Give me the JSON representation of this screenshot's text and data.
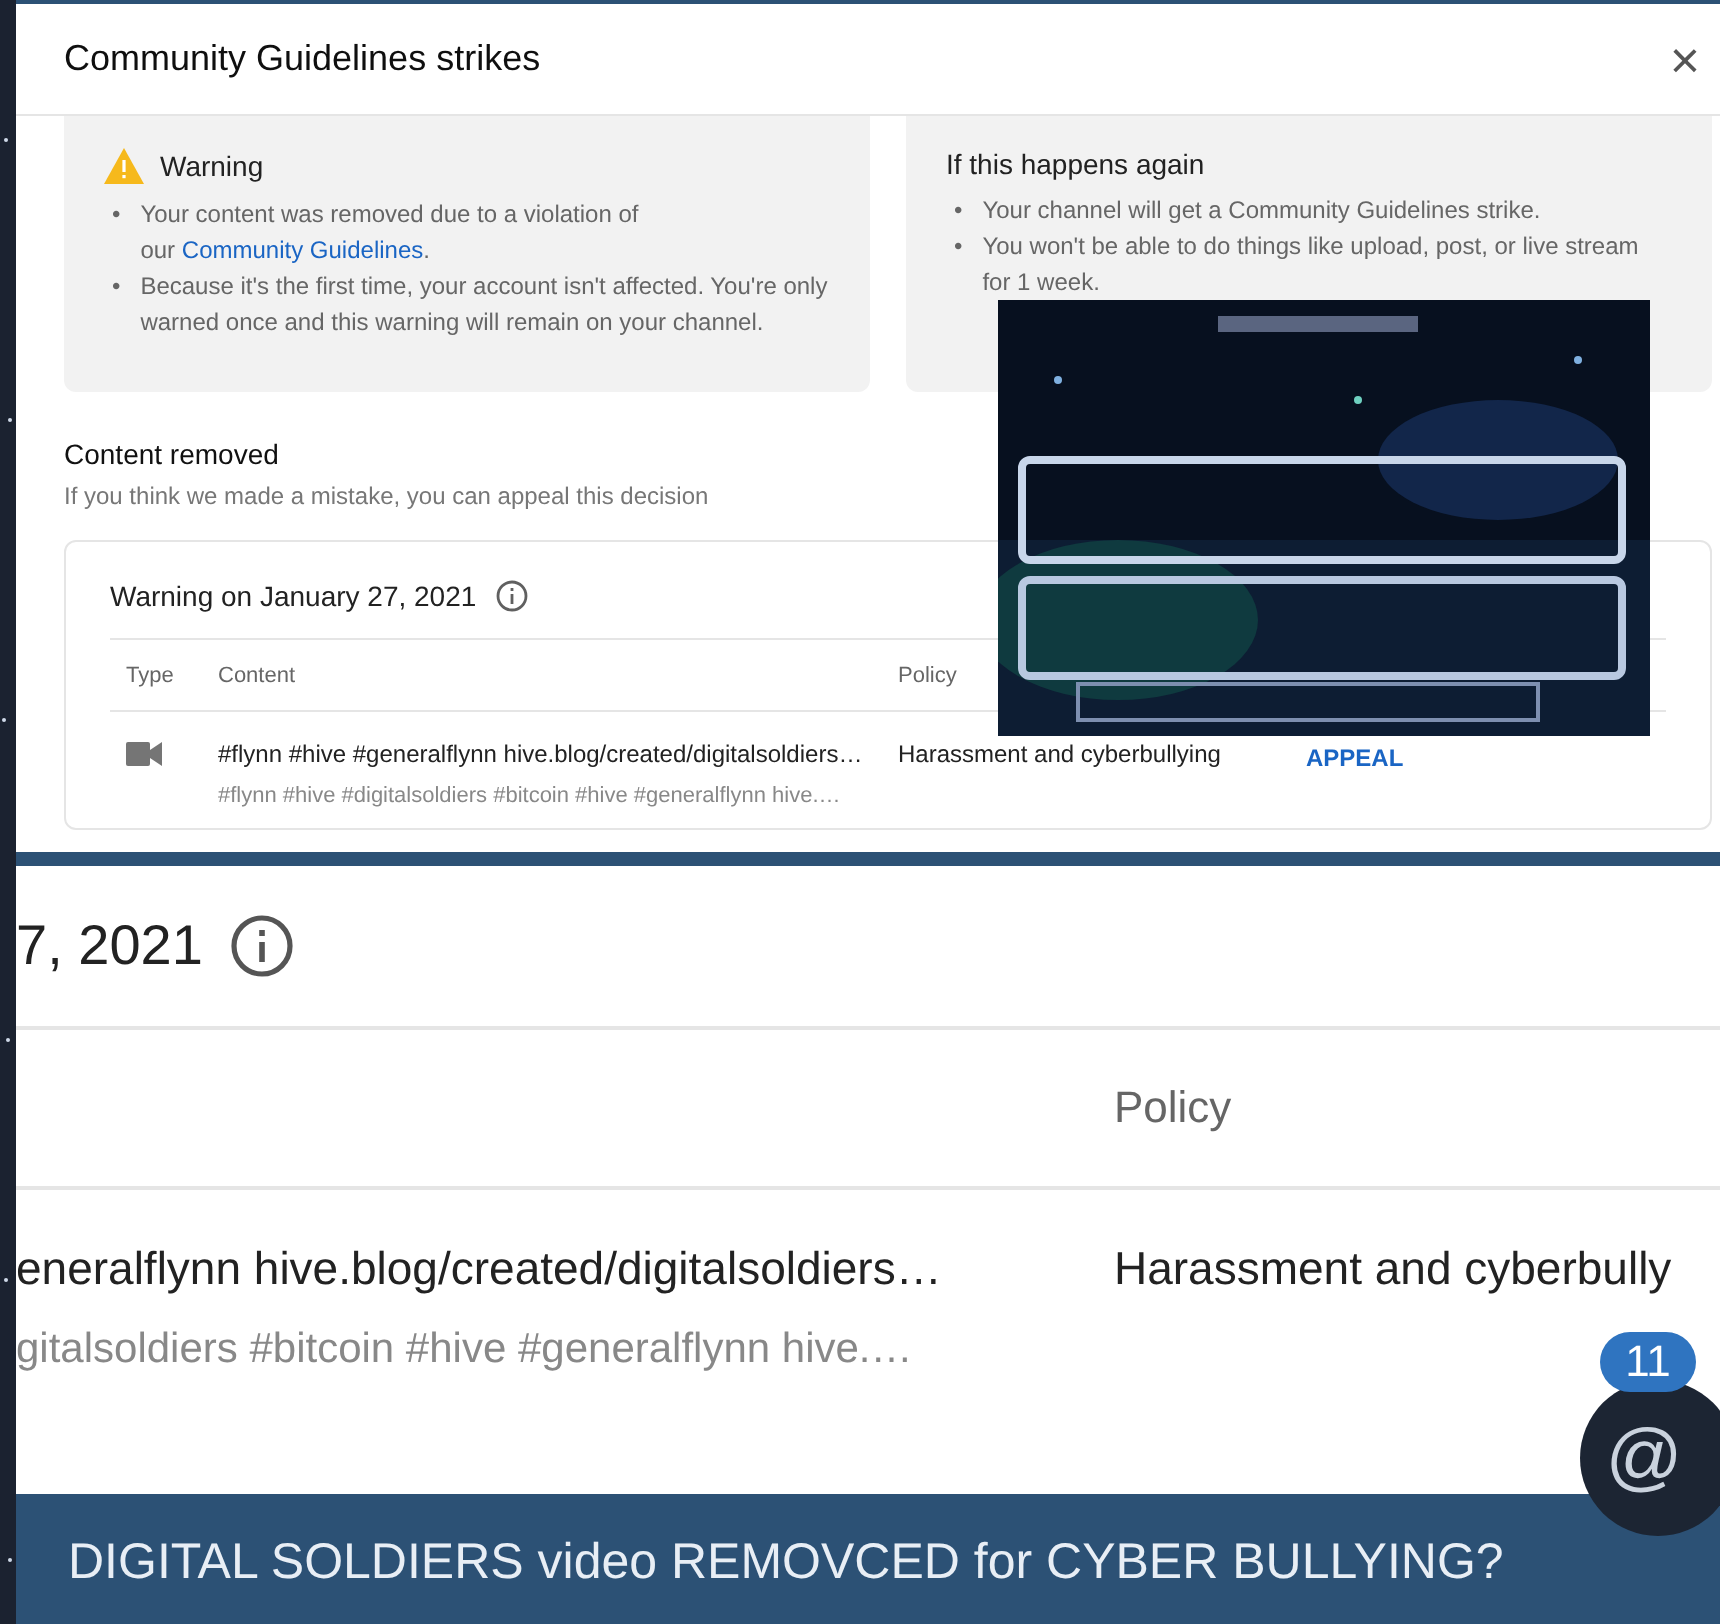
{
  "dialog": {
    "title": "Community Guidelines strikes",
    "close": "×",
    "warning_card": {
      "title": "Warning",
      "bullets": [
        {
          "marker": "•",
          "text": "Your content was removed due to a violation of our",
          "link": "Community Guidelines",
          "after": "."
        },
        {
          "marker": "•",
          "text": "Because it's the first time, your account isn't affected. You're only warned once and this warning will remain on your channel."
        }
      ]
    },
    "again_card": {
      "title": "If this happens again",
      "bullets": [
        {
          "marker": "•",
          "text": "Your channel will get a Community Guidelines strike."
        },
        {
          "marker": "•",
          "text": "You won't be able to do things like upload, post, or live stream for 1 week."
        }
      ]
    },
    "section_title": "Content removed",
    "section_hint": "If you think we made a mistake, you can appeal this decision",
    "table": {
      "title": "Warning on January 27, 2021",
      "columns": [
        "Type",
        "Content",
        "Policy"
      ],
      "rows": [
        {
          "kind": "video",
          "content": "#flynn #hive #generalflynn hive.blog/created/digitalsoldiers…",
          "description": "#flynn #hive #digitalsoldiers #bitcoin #hive #generalflynn hive.…",
          "policy": "Harassment and cyberbullying",
          "action": "APPEAL"
        }
      ]
    }
  },
  "zoomed": {
    "date": "7, 2021",
    "column": "Policy",
    "content": "eneralflynn hive.blog/created/digitalsoldiers…",
    "description": "gitalsoldiers #bitcoin #hive #generalflynn hive.…",
    "policy": "Harassment and cyberbully"
  },
  "notification": {
    "count": "11",
    "symbol": "@"
  },
  "caption": "DIGITAL SOLDIERS video REMOVCED for CYBER BULLYING?"
}
